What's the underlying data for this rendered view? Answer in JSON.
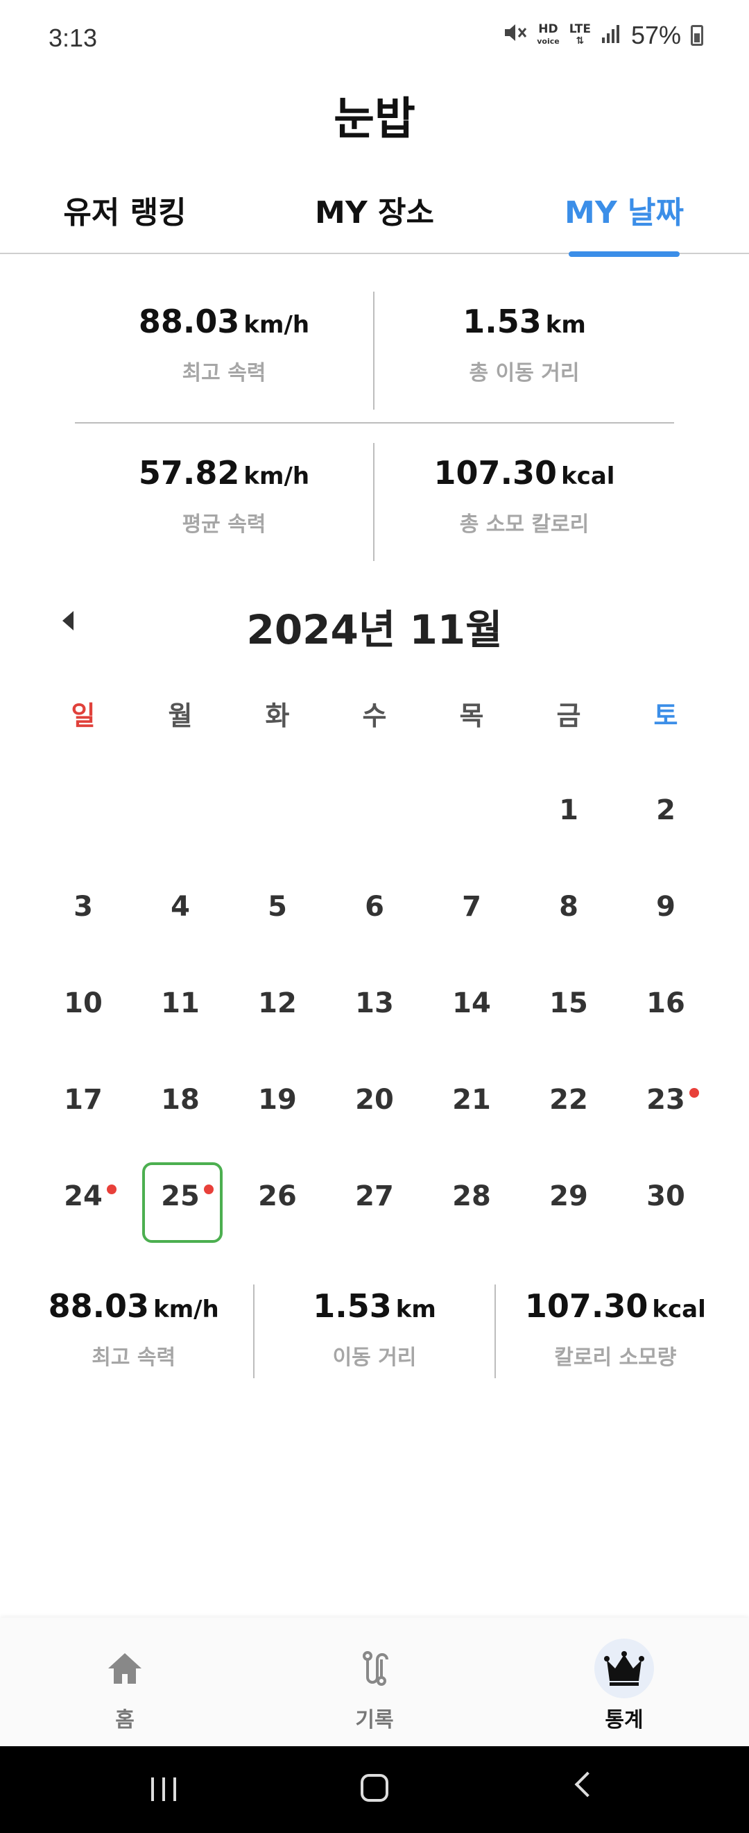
{
  "status_bar": {
    "time": "3:13",
    "hd_text": "HD",
    "voice_text": "voice",
    "lte_text": "LTE",
    "battery_text": "57%"
  },
  "app": {
    "title": "눈밥"
  },
  "tabs": [
    {
      "label": "유저 랭킹",
      "active": false
    },
    {
      "label": "MY 장소",
      "active": false
    },
    {
      "label": "MY 날짜",
      "active": true
    }
  ],
  "summary": {
    "max_speed": {
      "value": "88.03",
      "unit": "km/h",
      "label": "최고 속력"
    },
    "total_distance": {
      "value": "1.53",
      "unit": "km",
      "label": "총 이동 거리"
    },
    "avg_speed": {
      "value": "57.82",
      "unit": "km/h",
      "label": "평균 속력"
    },
    "total_calories": {
      "value": "107.30",
      "unit": "kcal",
      "label": "총 소모 칼로리"
    }
  },
  "calendar": {
    "title": "2024년 11월",
    "weekdays": [
      "일",
      "월",
      "화",
      "수",
      "목",
      "금",
      "토"
    ],
    "days": [
      "",
      "",
      "",
      "",
      "",
      "1",
      "2",
      "3",
      "4",
      "5",
      "6",
      "7",
      "8",
      "9",
      "10",
      "11",
      "12",
      "13",
      "14",
      "15",
      "16",
      "17",
      "18",
      "19",
      "20",
      "21",
      "22",
      "23",
      "24",
      "25",
      "26",
      "27",
      "28",
      "29",
      "30"
    ],
    "dot_days": [
      "23",
      "24",
      "25"
    ],
    "selected_day": "25"
  },
  "day_detail": {
    "max_speed": {
      "value": "88.03",
      "unit": "km/h",
      "label": "최고 속력"
    },
    "distance": {
      "value": "1.53",
      "unit": "km",
      "label": "이동 거리"
    },
    "calories": {
      "value": "107.30",
      "unit": "kcal",
      "label": "칼로리 소모량"
    }
  },
  "bottom_nav": [
    {
      "label": "홈",
      "icon": "home-icon"
    },
    {
      "label": "기록",
      "icon": "route-icon"
    },
    {
      "label": "통계",
      "icon": "crown-icon",
      "active": true
    }
  ],
  "colors": {
    "accent": "#3b8ee8",
    "sunday": "#e0413b",
    "saturday": "#3b8ee8",
    "selected_border": "#4caf50",
    "event_dot": "#e8403a"
  }
}
